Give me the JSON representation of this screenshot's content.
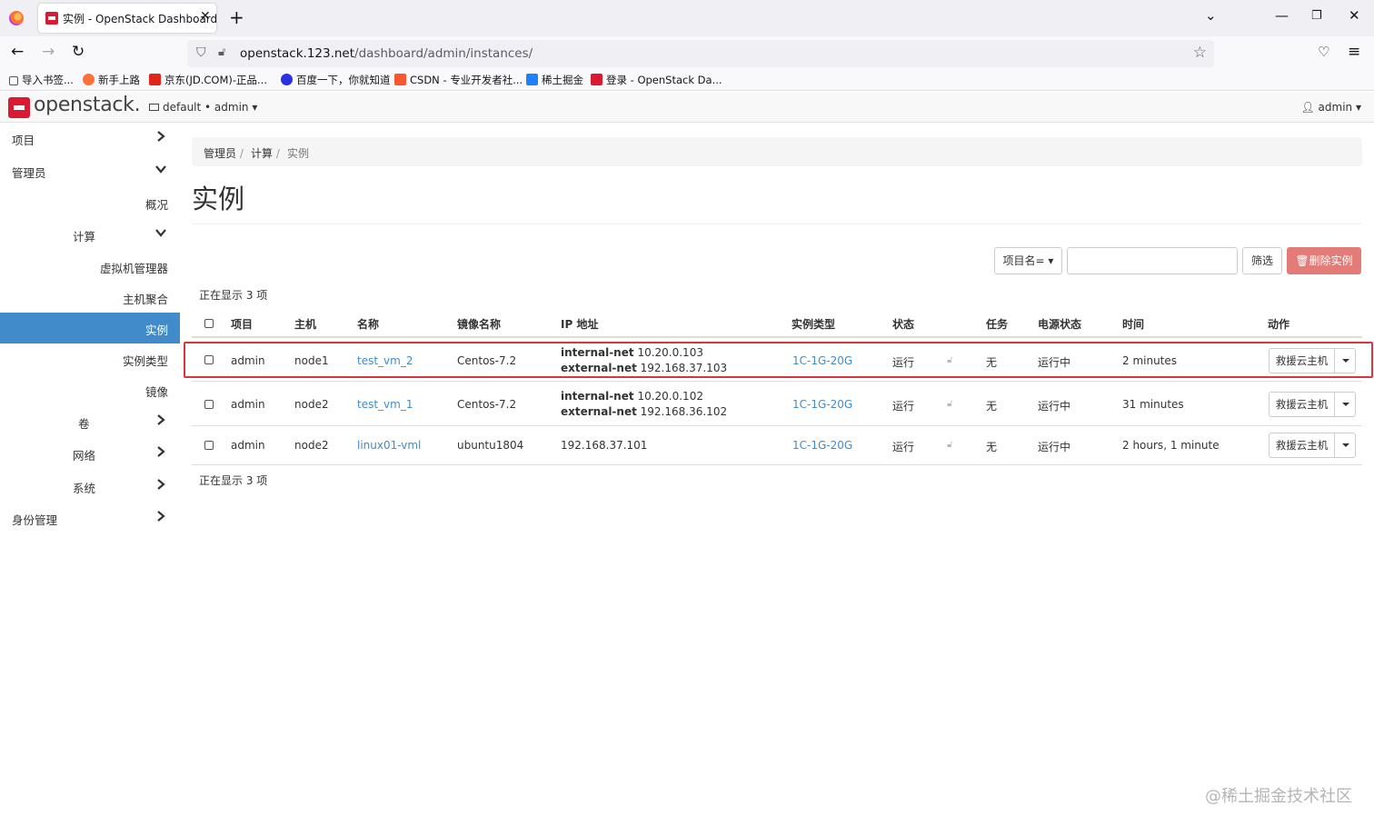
{
  "browser": {
    "tab_title": "实例 - OpenStack Dashboard",
    "url_host": "openstack.123.net",
    "url_path": "/dashboard/admin/instances/",
    "bookmarks": [
      "导入书签...",
      "新手上路",
      "京东(JD.COM)-正品...",
      "百度一下，你就知道",
      "CSDN - 专业开发者社...",
      "稀土掘金",
      "登录 - OpenStack Da..."
    ]
  },
  "header": {
    "logo": "openstack.",
    "project_selector": "default • admin",
    "user": "admin"
  },
  "sidebar": {
    "project": "项目",
    "admin": "管理员",
    "overview": "概况",
    "compute": "计算",
    "hypervisors": "虚拟机管理器",
    "host_aggregates": "主机聚合",
    "instances": "实例",
    "flavors": "实例类型",
    "images": "镜像",
    "volumes": "卷",
    "network": "网络",
    "system": "系统",
    "identity": "身份管理"
  },
  "breadcrumb": [
    "管理员",
    "计算",
    "实例"
  ],
  "page_title": "实例",
  "toolbar": {
    "filter_field": "项目名=",
    "filter_value": "",
    "filter_button": "筛选",
    "delete_button": "删除实例"
  },
  "count_text": "正在显示 3 项",
  "table": {
    "headers": [
      "项目",
      "主机",
      "名称",
      "镜像名称",
      "IP 地址",
      "实例类型",
      "状态",
      "任务",
      "电源状态",
      "时间",
      "动作"
    ],
    "rows": [
      {
        "project": "admin",
        "host": "node1",
        "name": "test_vm_2",
        "image": "Centos-7.2",
        "ip1_net": "internal-net",
        "ip1_addr": "10.20.0.103",
        "ip2_net": "external-net",
        "ip2_addr": "192.168.37.103",
        "flavor": "1C-1G-20G",
        "status": "运行",
        "task": "无",
        "power": "运行中",
        "time": "2 minutes",
        "action": "救援云主机"
      },
      {
        "project": "admin",
        "host": "node2",
        "name": "test_vm_1",
        "image": "Centos-7.2",
        "ip1_net": "internal-net",
        "ip1_addr": "10.20.0.102",
        "ip2_net": "external-net",
        "ip2_addr": "192.168.36.102",
        "flavor": "1C-1G-20G",
        "status": "运行",
        "task": "无",
        "power": "运行中",
        "time": "31 minutes",
        "action": "救援云主机"
      },
      {
        "project": "admin",
        "host": "node2",
        "name": "linux01-vml",
        "image": "ubuntu1804",
        "ip_single": "192.168.37.101",
        "flavor": "1C-1G-20G",
        "status": "运行",
        "task": "无",
        "power": "运行中",
        "time": "2 hours, 1 minute",
        "action": "救援云主机"
      }
    ]
  },
  "watermark": "@稀土掘金技术社区"
}
